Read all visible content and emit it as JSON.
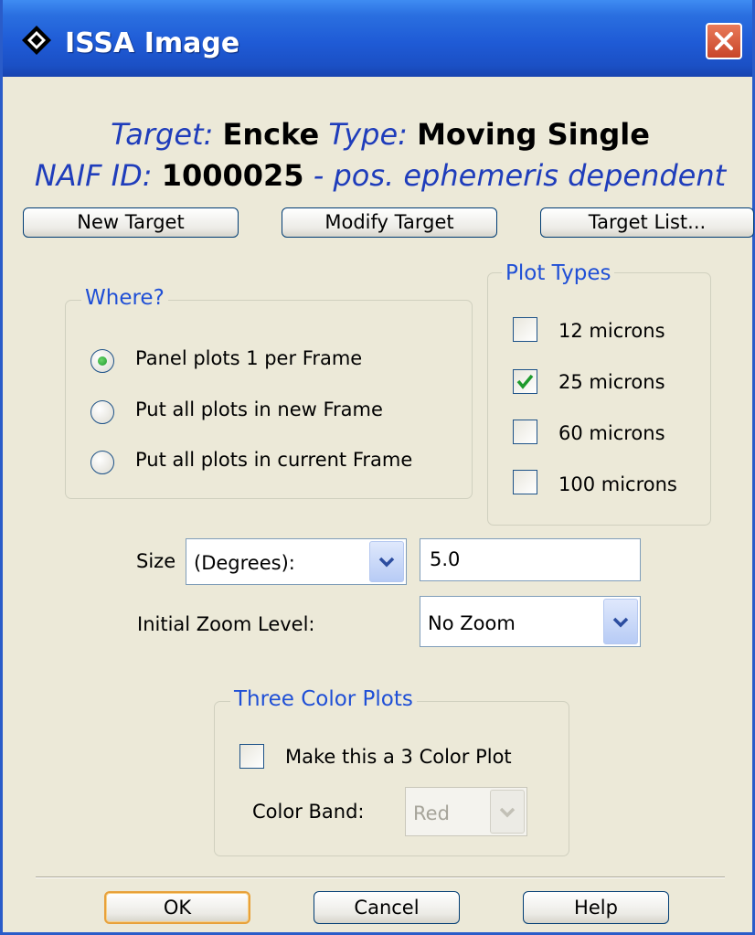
{
  "window": {
    "title": "ISSA Image",
    "icon": "diamond-app-icon",
    "close_icon": "close-icon"
  },
  "header": {
    "target_label": "Target:",
    "target_value": "Encke",
    "type_label": "Type:",
    "type_value": "Moving Single",
    "naif_label": "NAIF ID:",
    "naif_value": "1000025",
    "naif_note": "- pos. ephemeris dependent"
  },
  "target_buttons": {
    "new": "New Target",
    "modify": "Modify Target",
    "list": "Target List..."
  },
  "where": {
    "legend": "Where?",
    "options": [
      {
        "label": "Panel plots 1 per Frame",
        "selected": true
      },
      {
        "label": "Put all plots in new Frame",
        "selected": false
      },
      {
        "label": "Put all plots in current Frame",
        "selected": false
      }
    ]
  },
  "plot_types": {
    "legend": "Plot Types",
    "items": [
      {
        "label": "12 microns",
        "checked": false
      },
      {
        "label": "25 microns",
        "checked": true
      },
      {
        "label": "60 microns",
        "checked": false
      },
      {
        "label": "100 microns",
        "checked": false
      }
    ]
  },
  "size": {
    "label": "Size",
    "unit_selected": "(Degrees):",
    "value": "5.0"
  },
  "zoom": {
    "label": "Initial Zoom Level:",
    "selected": "No Zoom"
  },
  "three_color": {
    "legend": "Three Color Plots",
    "checkbox_label": "Make this a 3 Color Plot",
    "checked": false,
    "band_label": "Color Band:",
    "band_selected": "Red",
    "band_enabled": false
  },
  "footer": {
    "ok": "OK",
    "cancel": "Cancel",
    "help": "Help"
  },
  "colors": {
    "titlebar": "#1f5bd6",
    "label_blue": "#1f3dbb",
    "legend_blue": "#1f4fd6",
    "check_green": "#1d9a2c",
    "face": "#ece9d8"
  }
}
